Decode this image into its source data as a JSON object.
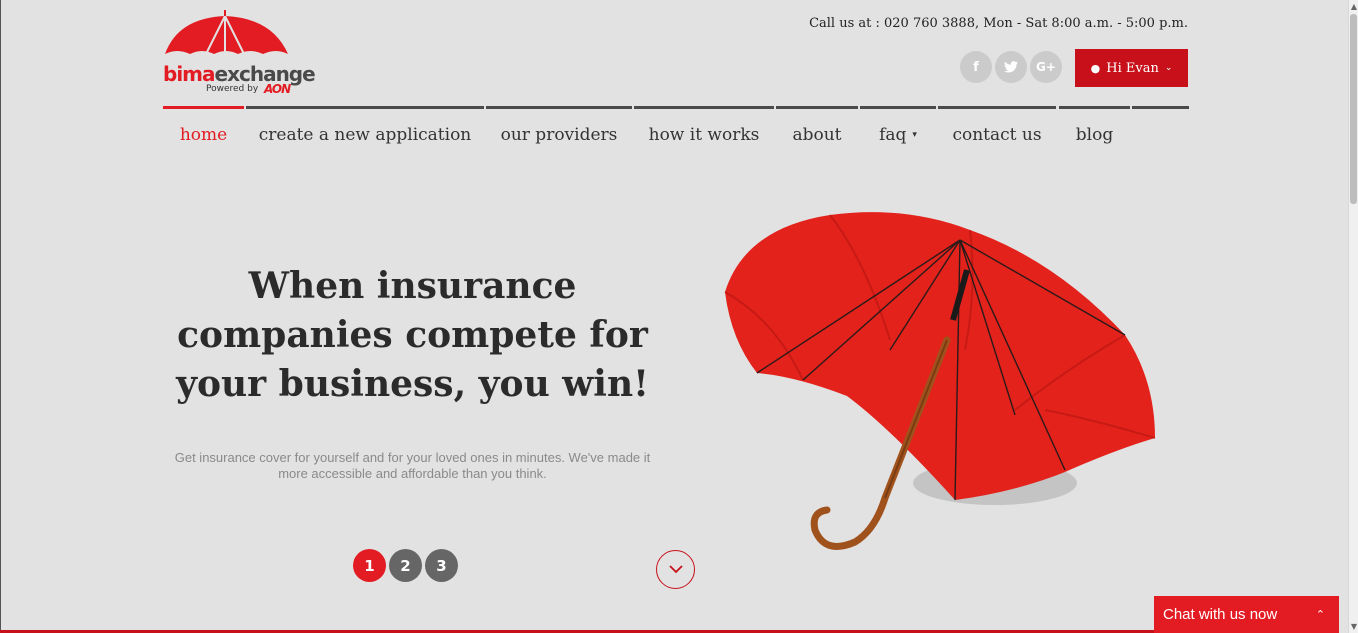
{
  "brand": {
    "word_red": "bima",
    "word_grey": "exchange",
    "powered_by": "Powered by",
    "partner": "AON",
    "brand_color": "#e31b23"
  },
  "header": {
    "call_line": "Call us at : 020 760 3888, Mon - Sat 8:00 a.m. - 5:00 p.m.",
    "social": [
      {
        "name": "facebook-icon",
        "glyph": "f"
      },
      {
        "name": "twitter-icon",
        "glyph": "t"
      },
      {
        "name": "google-plus-icon",
        "glyph": "G+"
      }
    ],
    "user_button": {
      "label": "Hi Evan",
      "icon": "person-icon",
      "chevron": "chevron-down-icon"
    }
  },
  "nav": {
    "items": [
      {
        "label": "home",
        "active": true
      },
      {
        "label": "create a new application"
      },
      {
        "label": "our providers"
      },
      {
        "label": "how it works"
      },
      {
        "label": "about"
      },
      {
        "label": "faq",
        "has_dropdown": true
      },
      {
        "label": "contact us"
      },
      {
        "label": "blog"
      }
    ]
  },
  "hero": {
    "title_line1": "When insurance",
    "title_line2": "companies compete for",
    "title_line3": "your business, you win!",
    "subtitle_line1": "Get insurance cover for yourself and for your loved ones in minutes. We've made it",
    "subtitle_line2": "more accessible and affordable than you think.",
    "pager": [
      "1",
      "2",
      "3"
    ],
    "active_page": "1",
    "scroll_icon": "chevron-down-icon",
    "image": "red-umbrella"
  },
  "chat": {
    "label": "Chat with us now",
    "icon": "chevron-up-icon"
  }
}
